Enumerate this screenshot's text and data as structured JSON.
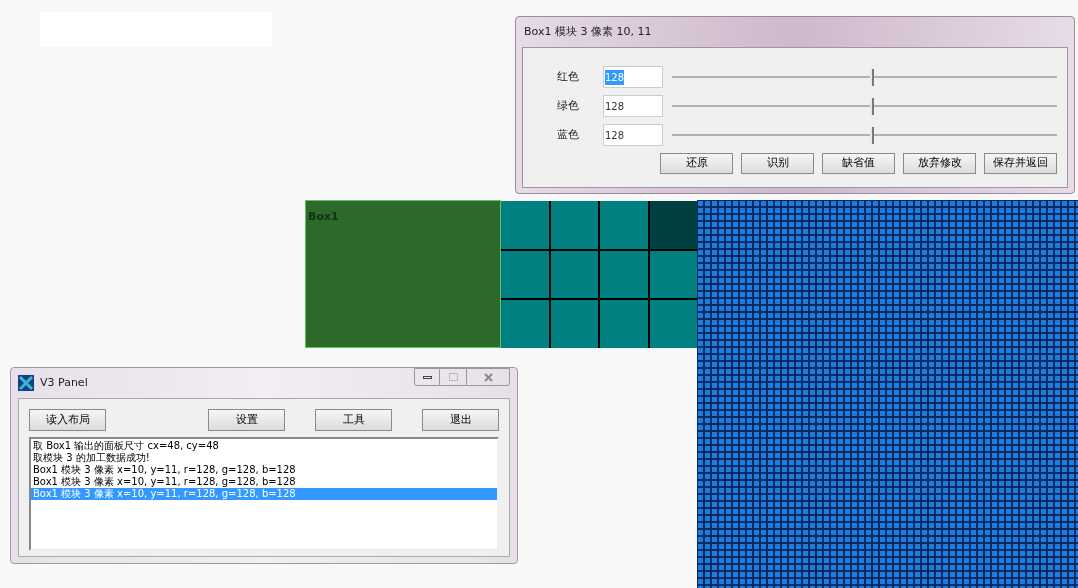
{
  "canvas": {
    "box": {
      "label": "Box1"
    },
    "module_cells": [
      {
        "color": "#008080"
      },
      {
        "color": "#008080"
      },
      {
        "color": "#008080"
      },
      {
        "color": "#004040"
      },
      {
        "color": "#008080"
      },
      {
        "color": "#008080"
      },
      {
        "color": "#008080"
      },
      {
        "color": "#008080"
      },
      {
        "color": "#008080"
      },
      {
        "color": "#008080"
      },
      {
        "color": "#008080"
      },
      {
        "color": "#008080"
      }
    ]
  },
  "pixel_dialog": {
    "title": "Box1 模块 3 像素 10, 11",
    "channels": [
      {
        "label": "红色",
        "value": "128",
        "highlighted": true,
        "level": 0.52
      },
      {
        "label": "绿色",
        "value": "128",
        "highlighted": false,
        "level": 0.52
      },
      {
        "label": "蓝色",
        "value": "128",
        "highlighted": false,
        "level": 0.52
      }
    ],
    "buttons": [
      "还原",
      "识别",
      "缺省值",
      "放弃修改",
      "保存并返回"
    ]
  },
  "panel": {
    "title": "V3 Panel",
    "buttons_left": [
      "读入布局"
    ],
    "buttons_right": [
      "设置",
      "工具",
      "退出"
    ],
    "log": [
      {
        "text": "取 Box1 输出的面板尺寸 cx=48, cy=48",
        "selected": false
      },
      {
        "text": "取模块 3 的加工数据成功!",
        "selected": false
      },
      {
        "text": "Box1 模块 3 像素 x=10, y=11, r=128, g=128, b=128",
        "selected": false
      },
      {
        "text": "Box1 模块 3 像素 x=10, y=11, r=128, g=128, b=128",
        "selected": false
      },
      {
        "text": "Box1 模块 3 像素 x=10, y=11, r=128, g=128, b=128",
        "selected": true
      }
    ]
  }
}
